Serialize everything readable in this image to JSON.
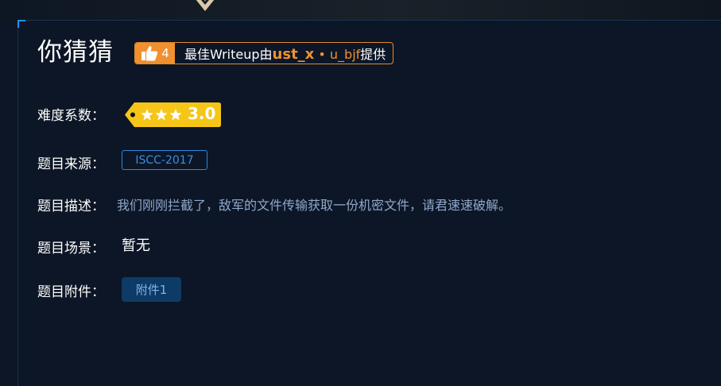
{
  "challenge": {
    "title": "你猜猜",
    "writeup": {
      "likes": "4",
      "prefix": "最佳Writeup由",
      "user1": "ust_x",
      "separator": " • ",
      "user2": "u_bjf",
      "suffix": "提供"
    },
    "difficulty": {
      "label": "难度系数：",
      "stars": 3,
      "value": "3.0"
    },
    "source": {
      "label": "题目来源：",
      "value": "ISCC-2017"
    },
    "description": {
      "label": "题目描述：",
      "value": "我们刚刚拦截了，敌军的文件传输获取一份机密文件，请君速速破解。"
    },
    "scene": {
      "label": "题目场景：",
      "value": "暂无"
    },
    "attachment": {
      "label": "题目附件：",
      "button": "附件1"
    }
  },
  "colors": {
    "background": "#0c1626",
    "accent_orange": "#f0902f",
    "tag_yellow": "#f5c518",
    "link_blue": "#2e86de",
    "desc_text": "#8fa8cc"
  },
  "icons": [
    "thumbs-up-icon",
    "star-icon",
    "ornament-icon"
  ]
}
